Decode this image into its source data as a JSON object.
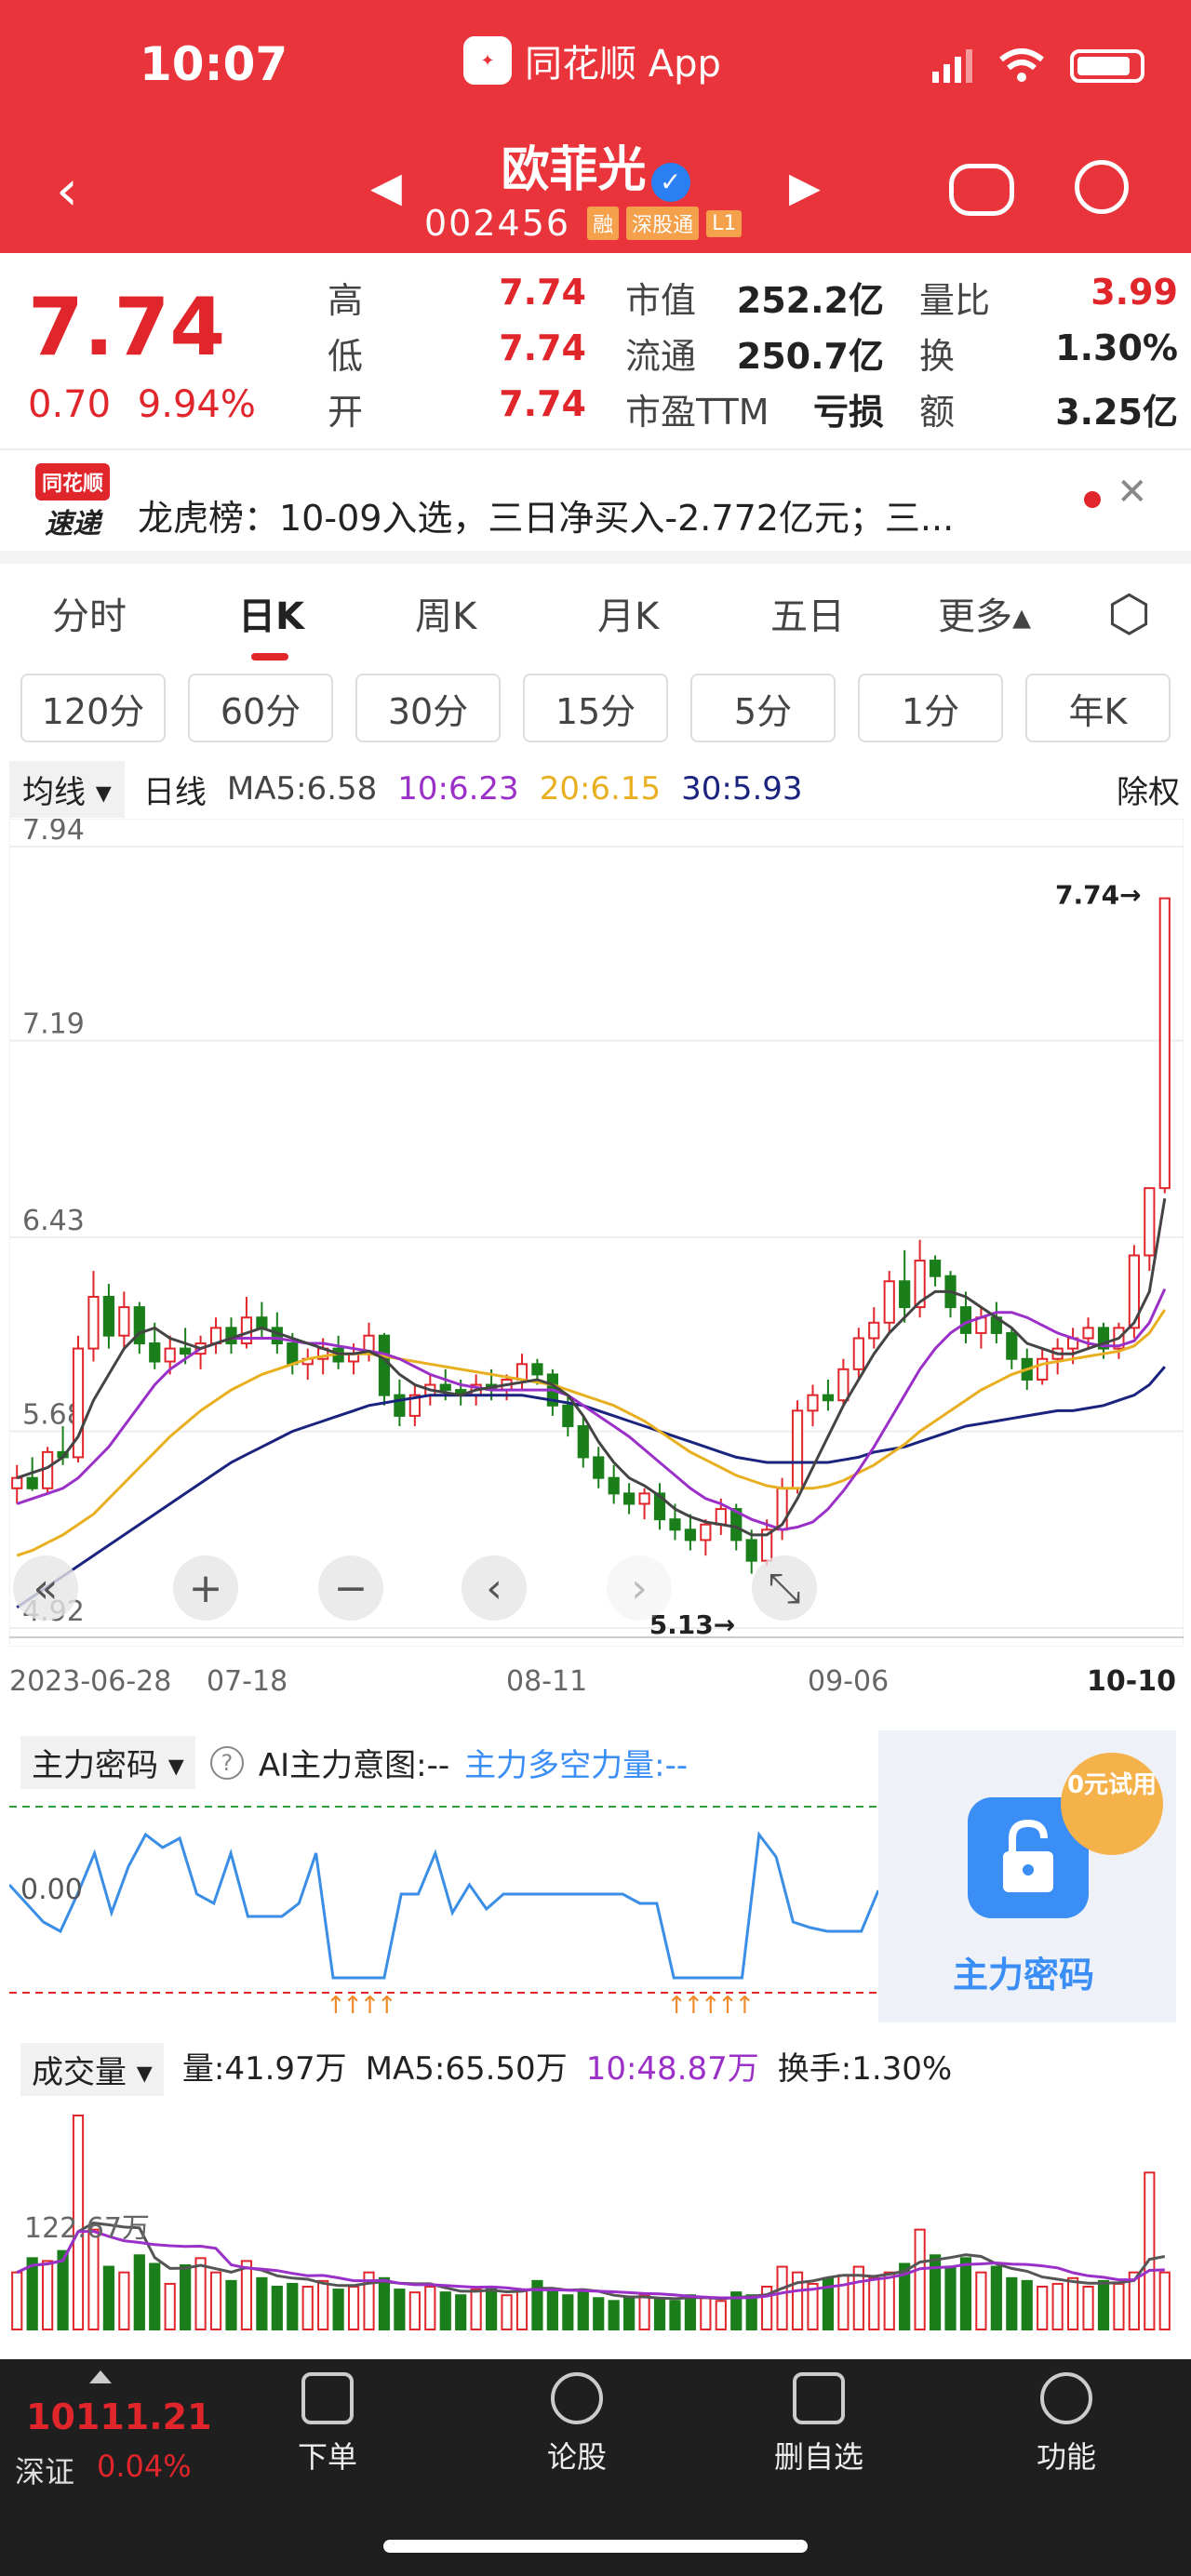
{
  "status": {
    "time": "10:07",
    "app": "同花顺 App"
  },
  "stock": {
    "name": "欧菲光",
    "code": "002456",
    "tags": [
      "融",
      "深股通",
      "L1"
    ]
  },
  "quote": {
    "price": "7.74",
    "change": "0.70",
    "change_pct": "9.94%",
    "rows": [
      {
        "l1": "高",
        "v1": "7.74",
        "l2": "市值",
        "v2": "252.2亿",
        "l3": "量比",
        "v3": "3.99"
      },
      {
        "l1": "低",
        "v1": "7.74",
        "l2": "流通",
        "v2": "250.7亿",
        "l3": "换",
        "v3": "1.30%"
      },
      {
        "l1": "开",
        "v1": "7.74",
        "l2": "市盈TTM",
        "v2": "亏损",
        "l3": "额",
        "v3": "3.25亿"
      }
    ]
  },
  "news": {
    "source_top": "同花顺",
    "source_bottom": "速递",
    "text": "龙虎榜：10-09入选，三日净买入-2.772亿元；三..."
  },
  "tabs": [
    "分时",
    "日K",
    "周K",
    "月K",
    "五日",
    "更多▴"
  ],
  "periods": [
    "120分",
    "60分",
    "30分",
    "15分",
    "5分",
    "1分",
    "年K"
  ],
  "ma": {
    "btn": "均线 ▾",
    "type": "日线",
    "ma5": "MA5:6.58",
    "ma10": "10:6.23",
    "ma20": "20:6.15",
    "ma30": "30:5.93",
    "adj": "除权"
  },
  "colors": {
    "red": "#e0252b",
    "green": "#1a7f1a",
    "ma5": "#444444",
    "ma10": "#9b30c9",
    "ma20": "#e8b020",
    "ma30": "#1a237e"
  },
  "chart_data": {
    "type": "candlestick",
    "y_ticks": [
      "7.94",
      "7.19",
      "6.43",
      "5.68",
      "4.92"
    ],
    "x_labels": [
      "2023-06-28",
      "07-18",
      "08-11",
      "09-06",
      "10-10"
    ],
    "annotations": {
      "high": "7.74→",
      "low": "5.13→"
    },
    "ylim": [
      4.92,
      7.94
    ],
    "candles": [
      [
        5.46,
        5.55,
        5.4,
        5.5
      ],
      [
        5.5,
        5.58,
        5.45,
        5.46
      ],
      [
        5.46,
        5.62,
        5.44,
        5.6
      ],
      [
        5.6,
        5.7,
        5.55,
        5.58
      ],
      [
        5.58,
        6.05,
        5.56,
        6.0
      ],
      [
        6.0,
        6.3,
        5.95,
        6.2
      ],
      [
        6.2,
        6.25,
        6.0,
        6.05
      ],
      [
        6.05,
        6.22,
        6.0,
        6.16
      ],
      [
        6.16,
        6.18,
        5.98,
        6.02
      ],
      [
        6.02,
        6.1,
        5.92,
        5.95
      ],
      [
        5.95,
        6.05,
        5.9,
        6.0
      ],
      [
        6.0,
        6.08,
        5.94,
        5.98
      ],
      [
        5.98,
        6.05,
        5.92,
        6.02
      ],
      [
        6.02,
        6.12,
        5.98,
        6.08
      ],
      [
        6.08,
        6.12,
        5.98,
        6.02
      ],
      [
        6.02,
        6.2,
        6.0,
        6.12
      ],
      [
        6.12,
        6.18,
        6.04,
        6.08
      ],
      [
        6.08,
        6.14,
        5.98,
        6.02
      ],
      [
        6.02,
        6.06,
        5.9,
        5.94
      ],
      [
        5.94,
        6.0,
        5.88,
        5.96
      ],
      [
        5.96,
        6.04,
        5.9,
        6.0
      ],
      [
        6.0,
        6.05,
        5.92,
        5.95
      ],
      [
        5.95,
        6.02,
        5.9,
        5.98
      ],
      [
        5.98,
        6.1,
        5.95,
        6.05
      ],
      [
        6.05,
        6.06,
        5.78,
        5.82
      ],
      [
        5.82,
        5.88,
        5.7,
        5.74
      ],
      [
        5.74,
        5.86,
        5.7,
        5.82
      ],
      [
        5.82,
        5.9,
        5.78,
        5.86
      ],
      [
        5.86,
        5.92,
        5.8,
        5.84
      ],
      [
        5.84,
        5.88,
        5.78,
        5.82
      ],
      [
        5.82,
        5.9,
        5.78,
        5.86
      ],
      [
        5.86,
        5.92,
        5.8,
        5.84
      ],
      [
        5.84,
        5.9,
        5.8,
        5.88
      ],
      [
        5.88,
        5.98,
        5.84,
        5.94
      ],
      [
        5.94,
        5.96,
        5.86,
        5.9
      ],
      [
        5.9,
        5.92,
        5.74,
        5.78
      ],
      [
        5.78,
        5.82,
        5.66,
        5.7
      ],
      [
        5.7,
        5.74,
        5.54,
        5.58
      ],
      [
        5.58,
        5.62,
        5.46,
        5.5
      ],
      [
        5.5,
        5.55,
        5.4,
        5.44
      ],
      [
        5.44,
        5.48,
        5.36,
        5.4
      ],
      [
        5.4,
        5.46,
        5.34,
        5.44
      ],
      [
        5.44,
        5.48,
        5.3,
        5.34
      ],
      [
        5.34,
        5.4,
        5.26,
        5.3
      ],
      [
        5.3,
        5.36,
        5.22,
        5.26
      ],
      [
        5.26,
        5.34,
        5.2,
        5.32
      ],
      [
        5.32,
        5.42,
        5.28,
        5.38
      ],
      [
        5.38,
        5.4,
        5.22,
        5.26
      ],
      [
        5.26,
        5.3,
        5.13,
        5.18
      ],
      [
        5.18,
        5.34,
        5.16,
        5.3
      ],
      [
        5.3,
        5.5,
        5.26,
        5.46
      ],
      [
        5.46,
        5.8,
        5.44,
        5.76
      ],
      [
        5.76,
        5.86,
        5.7,
        5.82
      ],
      [
        5.82,
        5.88,
        5.76,
        5.8
      ],
      [
        5.8,
        5.96,
        5.78,
        5.92
      ],
      [
        5.92,
        6.08,
        5.88,
        6.04
      ],
      [
        6.04,
        6.16,
        6.0,
        6.1
      ],
      [
        6.1,
        6.3,
        6.06,
        6.26
      ],
      [
        6.26,
        6.38,
        6.1,
        6.16
      ],
      [
        6.16,
        6.42,
        6.12,
        6.34
      ],
      [
        6.34,
        6.36,
        6.24,
        6.28
      ],
      [
        6.28,
        6.3,
        6.12,
        6.16
      ],
      [
        6.16,
        6.22,
        6.02,
        6.06
      ],
      [
        6.06,
        6.16,
        6.0,
        6.12
      ],
      [
        6.12,
        6.18,
        6.02,
        6.06
      ],
      [
        6.06,
        6.08,
        5.92,
        5.96
      ],
      [
        5.96,
        6.0,
        5.84,
        5.88
      ],
      [
        5.88,
        6.0,
        5.86,
        5.96
      ],
      [
        5.96,
        6.04,
        5.9,
        6.0
      ],
      [
        6.0,
        6.08,
        5.94,
        6.04
      ],
      [
        6.04,
        6.12,
        6.0,
        6.08
      ],
      [
        6.08,
        6.1,
        5.96,
        6.0
      ],
      [
        6.0,
        6.1,
        5.96,
        6.08
      ],
      [
        6.08,
        6.4,
        6.04,
        6.36
      ],
      [
        6.36,
        6.62,
        6.3,
        6.62
      ],
      [
        6.62,
        7.74,
        6.6,
        7.74
      ]
    ],
    "ma5": [
      5.5,
      5.52,
      5.54,
      5.58,
      5.66,
      5.8,
      5.9,
      6.0,
      6.06,
      6.08,
      6.04,
      6.02,
      6.0,
      6.02,
      6.04,
      6.06,
      6.08,
      6.06,
      6.04,
      6.02,
      6.0,
      5.98,
      5.98,
      5.99,
      5.96,
      5.9,
      5.86,
      5.84,
      5.83,
      5.82,
      5.84,
      5.85,
      5.86,
      5.87,
      5.88,
      5.86,
      5.82,
      5.74,
      5.64,
      5.56,
      5.5,
      5.47,
      5.43,
      5.38,
      5.35,
      5.33,
      5.32,
      5.31,
      5.28,
      5.28,
      5.32,
      5.42,
      5.54,
      5.66,
      5.78,
      5.88,
      5.98,
      6.06,
      6.12,
      6.18,
      6.22,
      6.22,
      6.2,
      6.16,
      6.12,
      6.08,
      6.02,
      6.0,
      5.98,
      5.98,
      6.0,
      6.02,
      6.04,
      6.1,
      6.22,
      6.58
    ],
    "ma10": [
      5.4,
      5.42,
      5.44,
      5.46,
      5.5,
      5.56,
      5.62,
      5.7,
      5.78,
      5.86,
      5.92,
      5.96,
      6.0,
      6.02,
      6.04,
      6.04,
      6.04,
      6.04,
      6.03,
      6.02,
      6.02,
      6.01,
      6.0,
      5.99,
      5.98,
      5.96,
      5.93,
      5.9,
      5.88,
      5.86,
      5.85,
      5.84,
      5.84,
      5.84,
      5.84,
      5.84,
      5.82,
      5.78,
      5.74,
      5.7,
      5.66,
      5.61,
      5.56,
      5.51,
      5.46,
      5.42,
      5.4,
      5.37,
      5.34,
      5.32,
      5.3,
      5.31,
      5.33,
      5.38,
      5.45,
      5.53,
      5.62,
      5.72,
      5.82,
      5.92,
      6.0,
      6.06,
      6.1,
      6.12,
      6.14,
      6.14,
      6.12,
      6.09,
      6.06,
      6.04,
      6.02,
      6.01,
      6.01,
      6.03,
      6.1,
      6.23
    ],
    "ma20": [
      5.2,
      5.22,
      5.25,
      5.28,
      5.32,
      5.36,
      5.42,
      5.48,
      5.54,
      5.6,
      5.66,
      5.71,
      5.76,
      5.8,
      5.84,
      5.87,
      5.9,
      5.92,
      5.94,
      5.96,
      5.97,
      5.98,
      5.98,
      5.98,
      5.97,
      5.96,
      5.95,
      5.94,
      5.93,
      5.92,
      5.91,
      5.9,
      5.89,
      5.88,
      5.87,
      5.86,
      5.84,
      5.82,
      5.8,
      5.78,
      5.75,
      5.72,
      5.68,
      5.64,
      5.6,
      5.57,
      5.54,
      5.51,
      5.49,
      5.47,
      5.46,
      5.46,
      5.46,
      5.47,
      5.49,
      5.52,
      5.55,
      5.59,
      5.63,
      5.68,
      5.72,
      5.76,
      5.8,
      5.84,
      5.87,
      5.9,
      5.92,
      5.94,
      5.95,
      5.96,
      5.97,
      5.98,
      5.99,
      6.01,
      6.06,
      6.15
    ],
    "ma30": [
      5.0,
      5.04,
      5.08,
      5.12,
      5.16,
      5.2,
      5.24,
      5.28,
      5.32,
      5.36,
      5.4,
      5.44,
      5.48,
      5.52,
      5.56,
      5.59,
      5.62,
      5.65,
      5.68,
      5.7,
      5.72,
      5.74,
      5.76,
      5.78,
      5.79,
      5.8,
      5.81,
      5.82,
      5.82,
      5.82,
      5.82,
      5.82,
      5.82,
      5.82,
      5.81,
      5.8,
      5.79,
      5.78,
      5.76,
      5.74,
      5.72,
      5.7,
      5.68,
      5.66,
      5.64,
      5.62,
      5.6,
      5.58,
      5.57,
      5.56,
      5.56,
      5.56,
      5.56,
      5.56,
      5.57,
      5.58,
      5.6,
      5.61,
      5.62,
      5.64,
      5.66,
      5.68,
      5.7,
      5.71,
      5.72,
      5.73,
      5.74,
      5.75,
      5.76,
      5.76,
      5.77,
      5.78,
      5.8,
      5.82,
      5.86,
      5.93
    ]
  },
  "controls": [
    "«",
    "+",
    "−",
    "‹",
    "›",
    "⤡"
  ],
  "secret": {
    "title": "主力密码 ▾",
    "help": "?",
    "ai": "AI主力意图:--",
    "power": "主力多空力量:--",
    "zero": "0.00",
    "lock_label": "主力密码",
    "trial": "0元试用",
    "line": [
      0.65,
      0.55,
      0.45,
      0.4,
      0.6,
      0.82,
      0.5,
      0.75,
      0.92,
      0.85,
      0.9,
      0.6,
      0.55,
      0.82,
      0.48,
      0.48,
      0.48,
      0.55,
      0.82,
      0.15,
      0.15,
      0.15,
      0.15,
      0.6,
      0.6,
      0.82,
      0.5,
      0.65,
      0.52,
      0.6,
      0.6,
      0.6,
      0.6,
      0.6,
      0.6,
      0.6,
      0.6,
      0.55,
      0.55,
      0.15,
      0.15,
      0.15,
      0.15,
      0.15,
      0.92,
      0.8,
      0.45,
      0.42,
      0.4,
      0.4,
      0.4,
      0.62
    ]
  },
  "volume": {
    "title": "成交量 ▾",
    "vol": "量:41.97万",
    "ma5": "MA5:65.50万",
    "ma10": "10:48.87万",
    "turnover": "换手:1.30%",
    "ref": "122.67万",
    "bars": [
      40,
      50,
      48,
      55,
      150,
      70,
      44,
      40,
      52,
      46,
      32,
      45,
      50,
      40,
      34,
      48,
      36,
      30,
      32,
      30,
      34,
      28,
      30,
      40,
      36,
      28,
      26,
      30,
      26,
      24,
      28,
      30,
      24,
      28,
      34,
      28,
      24,
      26,
      22,
      20,
      22,
      24,
      22,
      20,
      24,
      22,
      20,
      26,
      24,
      30,
      44,
      40,
      32,
      36,
      38,
      44,
      36,
      40,
      46,
      70,
      52,
      44,
      50,
      40,
      44,
      36,
      34,
      30,
      32,
      36,
      30,
      34,
      32,
      40,
      110,
      40
    ],
    "up": [
      1,
      0,
      1,
      0,
      1,
      1,
      0,
      1,
      0,
      0,
      1,
      0,
      1,
      1,
      0,
      1,
      0,
      0,
      0,
      1,
      1,
      0,
      1,
      1,
      0,
      0,
      1,
      1,
      0,
      0,
      1,
      0,
      1,
      1,
      0,
      0,
      0,
      0,
      0,
      0,
      0,
      1,
      0,
      0,
      0,
      1,
      1,
      0,
      0,
      1,
      1,
      1,
      1,
      0,
      1,
      1,
      1,
      1,
      0,
      1,
      0,
      0,
      0,
      1,
      0,
      0,
      0,
      1,
      1,
      1,
      1,
      0,
      1,
      1,
      1,
      1
    ]
  },
  "bottom": {
    "index_value": "10111.21",
    "index_name": "深证",
    "index_pct": "0.04%",
    "nav": [
      "下单",
      "论股",
      "删自选",
      "功能"
    ]
  }
}
